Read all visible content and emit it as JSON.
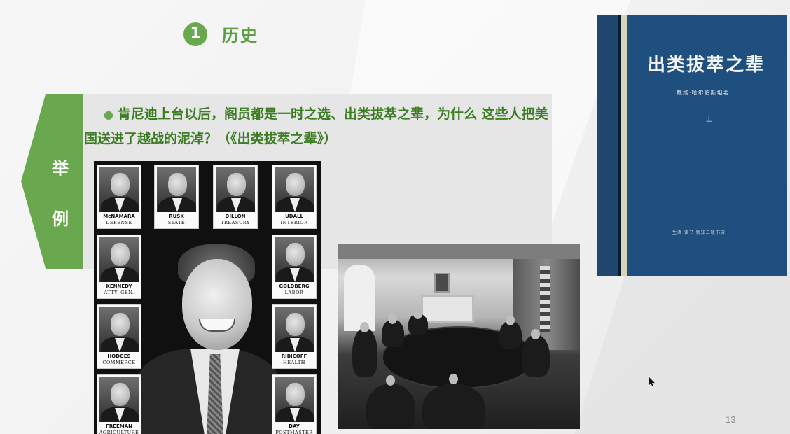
{
  "slide": {
    "badge": "1",
    "title": "历史",
    "example_tag": "举例",
    "question": "肯尼迪上台以后，阁员都是一时之选、出类拔萃之辈，为什么  这些人把美国送进了越战的泥淖？（《出类拔萃之辈》）",
    "page_number": "13"
  },
  "collage": {
    "portraits": [
      {
        "name": "McNAMARA",
        "role": "DEFENSE"
      },
      {
        "name": "RUSK",
        "role": "STATE"
      },
      {
        "name": "DILLON",
        "role": "TREASURY"
      },
      {
        "name": "UDALL",
        "role": "INTERIOR"
      },
      {
        "name": "KENNEDY",
        "role": "ATTY. GEN."
      },
      {
        "name": "GOLDBERG",
        "role": "LABOR"
      },
      {
        "name": "HODGES",
        "role": "COMMERCE"
      },
      {
        "name": "RIBICOFF",
        "role": "HEALTH"
      },
      {
        "name": "FREEMAN",
        "role": "AGRICULTURE"
      },
      {
        "name": "DAY",
        "role": "POSTMASTER"
      }
    ]
  },
  "book": {
    "title": "出类拔萃之辈",
    "author": "戴维·哈尔伯斯坦著",
    "volume": "上",
    "publisher": "生活·读书·新知三联书店"
  }
}
